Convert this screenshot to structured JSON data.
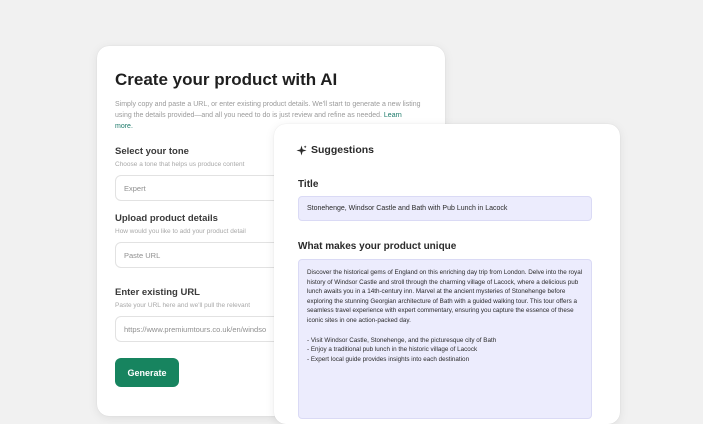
{
  "create": {
    "title": "Create your product with AI",
    "description": "Simply copy and paste a URL, or enter existing product details. We'll start to generate a new listing using the details provided—and all you need to do is just review and refine as needed.",
    "learn_more": "Learn more.",
    "tone": {
      "label": "Select your tone",
      "help": "Choose a tone that helps us produce content",
      "value": "Expert"
    },
    "upload": {
      "label": "Upload product details",
      "help": "How would you like to add your product detail",
      "value": "Paste URL"
    },
    "url": {
      "label": "Enter existing URL",
      "help": "Paste your URL here and we'll pull the relevant",
      "placeholder": "https://www.premiumtours.co.uk/en/windso"
    },
    "generate_label": "Generate"
  },
  "suggestions": {
    "heading": "Suggestions",
    "title_label": "Title",
    "title_value": "Stonehenge, Windsor Castle and Bath with Pub Lunch in Lacock",
    "unique_label": "What makes your product unique",
    "unique_paragraph": "Discover the historical gems of England on this enriching day trip from London. Delve into the royal history of Windsor Castle and stroll through the charming village of Lacock, where a delicious pub lunch awaits you in a 14th-century inn. Marvel at the ancient mysteries of Stonehenge before exploring the stunning Georgian architecture of Bath with a guided walking tour. This tour offers a seamless travel experience with expert commentary, ensuring you capture the essence of these iconic sites in one action-packed day.",
    "bullets": [
      "- Visit Windsor Castle, Stonehenge, and the picturesque city of Bath",
      "- Enjoy a traditional pub lunch in the historic village of Lacock",
      "- Expert local guide provides insights into each destination"
    ]
  },
  "colors": {
    "accent": "#17845f",
    "suggestion_bg": "#ececfd",
    "page_bg": "#f1f1f1"
  },
  "icons": {
    "suggestions": "sparkle-icon"
  }
}
